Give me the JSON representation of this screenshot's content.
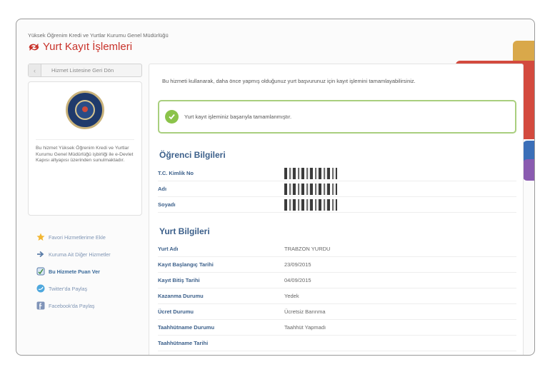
{
  "header": {
    "ministry": "Yüksek Öğrenim Kredi ve Yurtlar Kurumu Genel Müdürlüğü",
    "title": "Yurt Kayıt İşlemleri"
  },
  "sidebar": {
    "back_label": "Hizmet Listesine Geri Dön",
    "info_text": "Bu hizmet Yüksek Öğrenim Kredi ve Yurtlar Kurumu Genel Müdürlüğü işbirliği ile e-Devlet Kapısı altyapısı üzerinden sunulmaktadır.",
    "links": [
      {
        "label": "Favori Hizmetlerime Ekle",
        "icon": "star-icon"
      },
      {
        "label": "Kuruma Ait Diğer Hizmetler",
        "icon": "arrow-icon"
      },
      {
        "label": "Bu Hizmete Puan Ver",
        "icon": "rating-icon"
      },
      {
        "label": "Twitter'da Paylaş",
        "icon": "twitter-icon"
      },
      {
        "label": "Facebook'da Paylaş",
        "icon": "facebook-icon"
      }
    ]
  },
  "main": {
    "description": "Bu hizmeti kullanarak, daha önce yapmış olduğunuz yurt başvurunuz için kayıt işlemini tamamlayabilirsiniz.",
    "success_message": "Yurt kayıt işleminiz başarıyla tamamlanmıştır.",
    "student_section": {
      "title": "Öğrenci Bilgileri",
      "rows": [
        {
          "label": "T.C. Kimlik No"
        },
        {
          "label": "Adı"
        },
        {
          "label": "Soyadı"
        }
      ]
    },
    "dorm_section": {
      "title": "Yurt Bilgileri",
      "rows": [
        {
          "label": "Yurt Adı",
          "value": "TRABZON YURDU"
        },
        {
          "label": "Kayıt Başlangıç Tarihi",
          "value": "23/09/2015"
        },
        {
          "label": "Kayıt Bitiş Tarihi",
          "value": "04/09/2015"
        },
        {
          "label": "Kazanma Durumu",
          "value": "Yedek"
        },
        {
          "label": "Ücret Durumu",
          "value": "Ücretsiz Barınma"
        },
        {
          "label": "Taahhütname Durumu",
          "value": "Taahhüt Yapmadı"
        },
        {
          "label": "Taahhütname Tarihi",
          "value": ""
        }
      ]
    }
  },
  "colors": {
    "brand": "#c8322a",
    "label": "#3b5f8a",
    "success_border": "#a9cf7e"
  }
}
